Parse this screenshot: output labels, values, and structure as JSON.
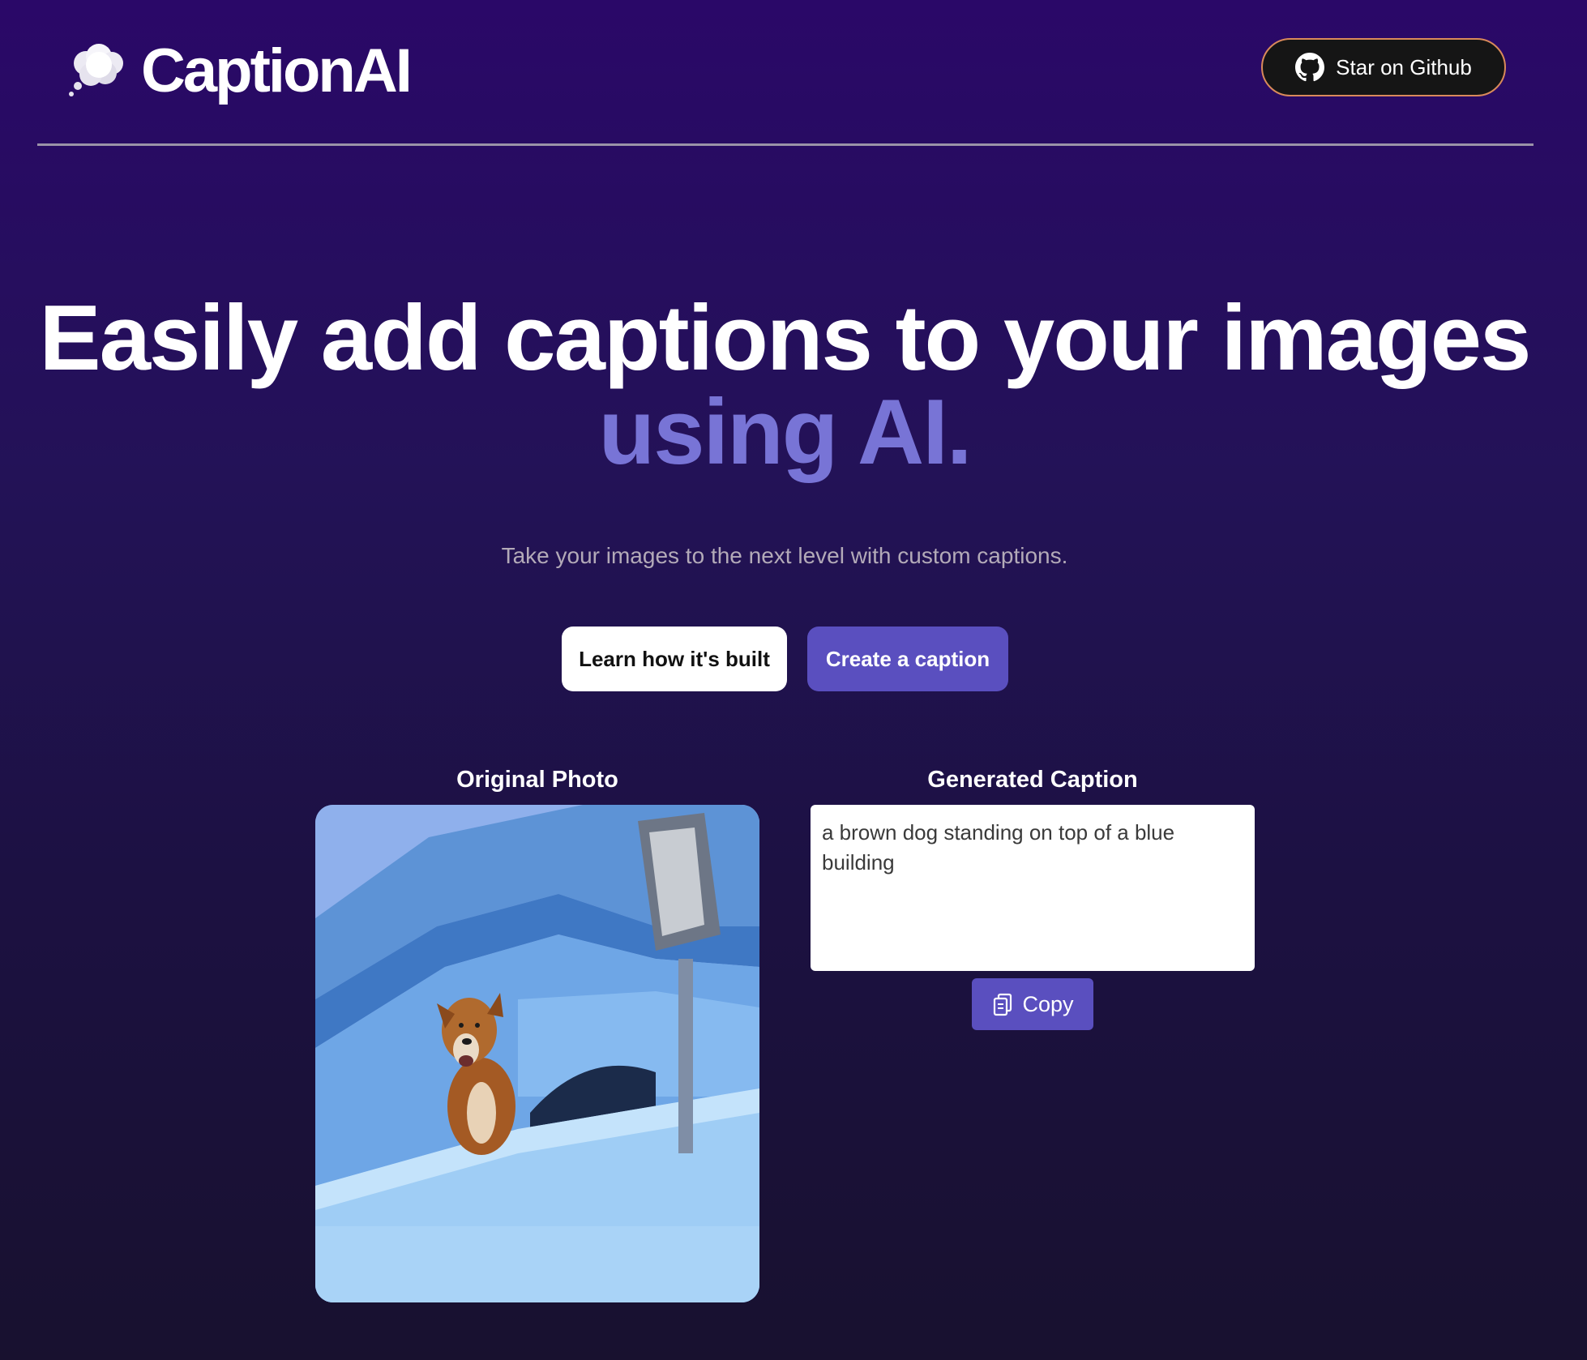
{
  "header": {
    "brand": "CaptionAI",
    "logo_icon": "thought-cloud-icon",
    "github_button_label": "Star on Github",
    "github_icon": "github-icon"
  },
  "hero": {
    "title_part1": "Easily add captions to your images ",
    "title_accent": "using AI.",
    "subtitle": "Take your images to the next level with custom captions."
  },
  "actions": {
    "learn_label": "Learn how it's built",
    "create_label": "Create a caption"
  },
  "original": {
    "label": "Original Photo"
  },
  "generated": {
    "label": "Generated Caption",
    "caption": "a brown dog standing on top of a blue building",
    "copy_label": "Copy",
    "copy_icon": "clipboard-icon"
  },
  "colors": {
    "background_top": "#2a0868",
    "background_bottom": "#18112f",
    "accent": "#7874d6",
    "button_primary": "#5a4fbf",
    "github_border": "#d98a5a"
  }
}
